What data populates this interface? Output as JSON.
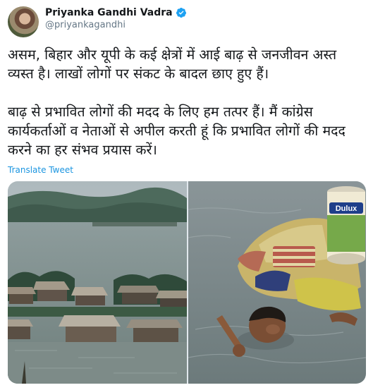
{
  "tweet": {
    "author_name": "Priyanka Gandhi Vadra",
    "author_handle": "@priyankagandhi",
    "paragraph_1": "असम, बिहार और यूपी के कई क्षेत्रों में आई बाढ़ से जनजीवन अस्त व्यस्त है। लाखों लोगों पर संकट के बादल छाए हुए हैं।",
    "paragraph_2": "बाढ़ से प्रभावित लोगों की मदद के लिए हम तत्पर हैं। मैं कांग्रेस कार्यकर्ताओं व नेताओं से अपील करती हूं कि प्रभावित लोगों की मदद करने का हर संभव प्रयास करें।",
    "translate_label": "Translate Tweet"
  },
  "icons": {
    "verified": "verified-badge-icon"
  },
  "colors": {
    "link": "#1b95e0",
    "verified": "#1da1f2",
    "handle": "#657786"
  },
  "media": {
    "paint_can_label": "Dulux"
  }
}
